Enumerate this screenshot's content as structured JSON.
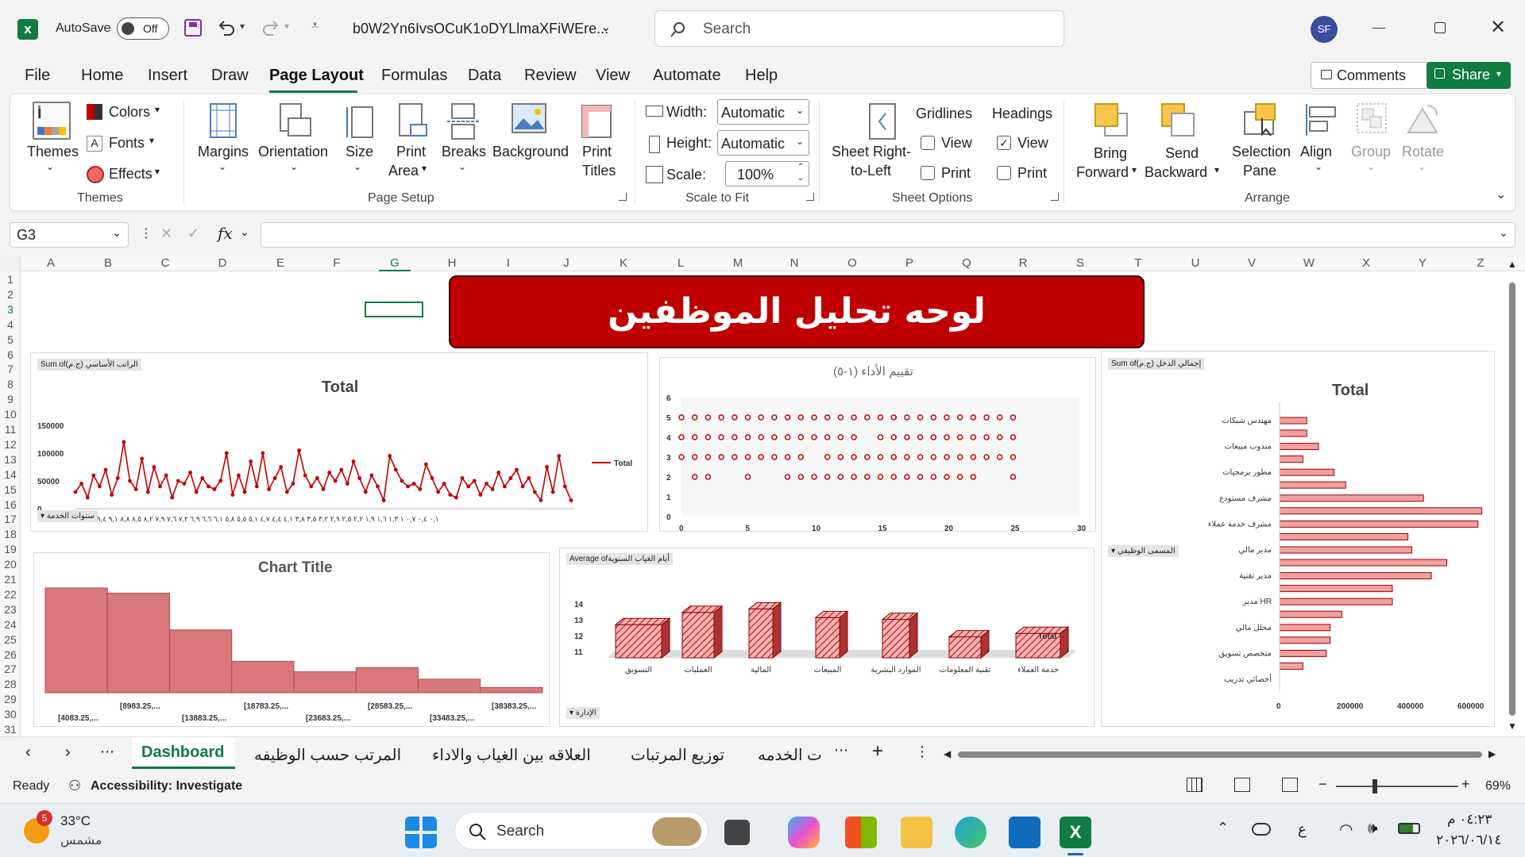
{
  "titlebar": {
    "autosave": "AutoSave",
    "toggle": "Off",
    "filename": "b0W2Yn6IvsOCuK1oDYLlmaXFiWEre...",
    "search": "Search",
    "avatar": "SF"
  },
  "menu": [
    "File",
    "Home",
    "Insert",
    "Draw",
    "Page Layout",
    "Formulas",
    "Data",
    "Review",
    "View",
    "Automate",
    "Help"
  ],
  "menu_right": {
    "comments": "Comments",
    "share": "Share"
  },
  "ribbon": {
    "themes": {
      "themes": "Themes",
      "colors": "Colors",
      "fonts": "Fonts",
      "effects": "Effects",
      "group": "Themes"
    },
    "page_setup": {
      "margins": "Margins",
      "orientation": "Orientation",
      "size": "Size",
      "print_area_1": "Print",
      "print_area_2": "Area",
      "breaks": "Breaks",
      "background": "Background",
      "print_titles_1": "Print",
      "print_titles_2": "Titles",
      "group": "Page Setup"
    },
    "scale": {
      "width": "Width:",
      "height": "Height:",
      "scale": "Scale:",
      "width_val": "Automatic",
      "height_val": "Automatic",
      "scale_val": "100%",
      "group": "Scale to Fit"
    },
    "sheet_options": {
      "sheet_rtl_1": "Sheet Right-",
      "sheet_rtl_2": "to-Left",
      "gridlines": "Gridlines",
      "headings": "Headings",
      "view": "View",
      "print": "Print",
      "group": "Sheet Options"
    },
    "arrange": {
      "bring_1": "Bring",
      "bring_2": "Forward",
      "send_1": "Send",
      "send_2": "Backward",
      "sel_1": "Selection",
      "sel_2": "Pane",
      "align": "Align",
      "grp": "Group",
      "rotate": "Rotate",
      "group": "Arrange"
    }
  },
  "formula": {
    "namebox": "G3",
    "fx": "fx"
  },
  "columns": [
    "A",
    "B",
    "C",
    "D",
    "E",
    "F",
    "G",
    "H",
    "I",
    "J",
    "K",
    "L",
    "M",
    "N",
    "O",
    "P",
    "Q",
    "R",
    "S",
    "T",
    "U",
    "V",
    "W",
    "X",
    "Y",
    "Z"
  ],
  "rows": [
    "1",
    "2",
    "3",
    "4",
    "5",
    "6",
    "7",
    "8",
    "9",
    "10",
    "11",
    "12",
    "13",
    "14",
    "15",
    "16",
    "17",
    "18",
    "19",
    "20",
    "21",
    "22",
    "23",
    "24",
    "25",
    "26",
    "27",
    "28",
    "29",
    "30",
    "31"
  ],
  "banner": "لوحه تحليل الموظفين",
  "chart1": {
    "pill": "Sum of(ج.م) الراتب الأساسي",
    "title": "Total",
    "legend": "Total",
    "filter": "سنوات الخدمة",
    "yticks": [
      "150000",
      "100000",
      "50000",
      "0"
    ],
    "xticks": "٠,١ ٠,٤ ٠,٧ ١ ١,٣ ١,٦ ١,٩ ٢,٢ ٢,٥ ٢,٩ ٣,٢ ٣,٥ ٣,٨ ٤,١ ٤,٤ ٤,٧ ٥,١ ٥,٥ ٥,٨ ٦,١ ٦,٦ ٦,٩ ٧,٢ ٧,٦ ٧,٩ ٨,٢ ٨,٥ ٨,٨ ٩,١ ٩,٤ ٩,٧ ١٠"
  },
  "chart2": {
    "title": "تقييم الأداء (١-٥)",
    "yticks": [
      "6",
      "5",
      "4",
      "3",
      "2",
      "1",
      "0"
    ],
    "xticks": [
      "0",
      "5",
      "10",
      "15",
      "20",
      "25",
      "30"
    ]
  },
  "chart3": {
    "pill": "Sum of(ج.م) إجمالي الدخل",
    "title": "Total",
    "filter": "المسمى الوظيفي",
    "cats": [
      "مهندس شبكات",
      "مندوب مبيعات",
      "مطور برمجيات",
      "مشرف مستودع",
      "مشرف خدمة عملاء",
      "مدير مالي",
      "مدير تقنية",
      "مدير HR",
      "محلل مالي",
      "متخصص تسويق",
      "أخصائي تدريب"
    ],
    "xticks": [
      "0",
      "200000",
      "400000",
      "600000"
    ]
  },
  "chart4": {
    "title": "Chart Title",
    "xlabels_top": [
      "[8983.25,...",
      "[18783.25,...",
      "[28583.25,...",
      "[38383.25,..."
    ],
    "xlabels_bot": [
      "[4083.25,...",
      "[13883.25,...",
      "[23683.25,...",
      "[33483.25,..."
    ]
  },
  "chart5": {
    "pill": "Average ofأيام الغياب السنوية",
    "legend": "Total",
    "filter": "الإدارة",
    "yticks": [
      "14",
      "13",
      "12",
      "11"
    ],
    "cats": [
      "التسويق",
      "العمليات",
      "المالية",
      "المبيعات",
      "الموارد البشرية",
      "تقنية المعلومات",
      "خدمة العملاء"
    ]
  },
  "tabs": [
    "Dashboard",
    "المرتب حسب الوظيفه",
    "العلاقه بين الغياب والاداء",
    "توزيع المرتبات",
    "ت الخدمه"
  ],
  "status": {
    "ready": "Ready",
    "access": "Accessibility: Investigate",
    "zoom": "69%"
  },
  "taskbar": {
    "temp": "33°C",
    "cond": "مشمس",
    "badge": "5",
    "search": "Search",
    "time": "٠٤:٢٣ م",
    "date": "٢٠٢٦/٠٦/١٤",
    "lang": "ع"
  },
  "colors": {
    "accent": "#c00000",
    "excel": "#107c41",
    "bar": "#e8a0a0",
    "barStroke": "#c0504d"
  },
  "chart_data": [
    {
      "type": "line",
      "title": "Total",
      "series": [
        {
          "name": "Total",
          "values": [
            30000,
            45000,
            20000,
            60000,
            40000,
            70000,
            25000,
            55000,
            120000,
            50000,
            35000,
            90000,
            30000,
            75000,
            40000,
            60000,
            20000,
            50000,
            45000,
            65000,
            30000,
            55000,
            40000,
            35000,
            50000,
            100000,
            25000,
            60000,
            30000,
            85000,
            40000,
            100000,
            35000,
            55000,
            75000,
            30000,
            45000,
            105000,
            60000,
            40000,
            55000,
            35000,
            65000,
            50000,
            70000,
            45000,
            85000,
            55000,
            30000,
            60000,
            40000,
            15000,
            95000,
            70000,
            50000,
            40000,
            45000,
            35000,
            80000,
            55000,
            30000,
            45000,
            25000,
            20000,
            55000,
            40000,
            50000,
            25000,
            45000,
            35000,
            65000,
            40000,
            55000,
            70000,
            40000,
            55000,
            30000,
            15000,
            75000,
            30000,
            95000,
            40000,
            15000
          ]
        }
      ],
      "ylim": [
        0,
        150000
      ]
    },
    {
      "type": "scatter",
      "title": "تقييم الأداء (١-٥)",
      "xlim": [
        0,
        30
      ],
      "ylim": [
        0,
        6
      ]
    },
    {
      "type": "bar",
      "title": "Total",
      "categories": [
        "مهندس شبكات",
        "مندوب مبيعات",
        "مطور برمجيات",
        "مشرف مستودع",
        "مشرف خدمة عملاء",
        "مدير مالي",
        "مدير تقنية",
        "مدير HR",
        "محلل مالي",
        "متخصص تسويق",
        "أخصائي تدريب"
      ],
      "values": [
        [
          70000,
          70000
        ],
        [
          100000,
          60000
        ],
        [
          140000,
          170000
        ],
        [
          370000,
          520000
        ],
        [
          510000,
          330000
        ],
        [
          340000,
          430000
        ],
        [
          390000,
          290000
        ],
        [
          290000,
          160000
        ],
        [
          130000,
          130000
        ],
        [
          120000,
          60000
        ]
      ],
      "xlim": [
        0,
        600000
      ]
    },
    {
      "type": "bar",
      "title": "Chart Title",
      "categories": [
        "[4083.25,...",
        "[8983.25,...",
        "[13883.25,...",
        "[18783.25,...",
        "[23683.25,...",
        "[28583.25,...",
        "[33483.25,...",
        "[38383.25,..."
      ],
      "values": [
        100,
        95,
        60,
        30,
        20,
        24,
        13,
        5
      ]
    },
    {
      "type": "bar",
      "title": "Total",
      "categories": [
        "التسويق",
        "العمليات",
        "المالية",
        "المبيعات",
        "الموارد البشرية",
        "تقنية المعلومات",
        "خدمة العملاء"
      ],
      "values": [
        12.5,
        13.2,
        13.4,
        12.9,
        12.8,
        11.8,
        12.0
      ],
      "ylim": [
        11,
        14
      ]
    }
  ]
}
